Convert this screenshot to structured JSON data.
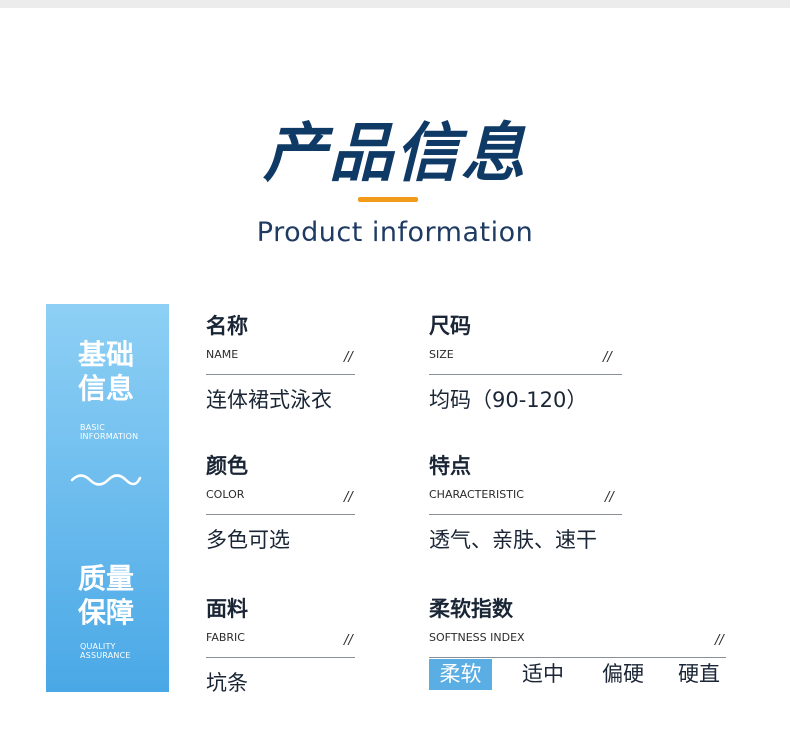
{
  "header": {
    "title": "产品信息",
    "subtitle": "Product information"
  },
  "colors": {
    "title": "#0f3a66",
    "accent_underline": "#f29a1a",
    "sidebar_top": "#8ed0f5",
    "sidebar_bottom": "#4aa8e6",
    "softness_active": "#5aaee3"
  },
  "sidebar": {
    "basic_title_line1": "基础",
    "basic_title_line2": "信息",
    "basic_sub_line1": "BASIC",
    "basic_sub_line2": "INFORMATION",
    "wave_icon": "wave-icon",
    "quality_title_line1": "质量",
    "quality_title_line2": "保障",
    "quality_sub_line1": "QUALITY",
    "quality_sub_line2": "ASSURANCE"
  },
  "fields": {
    "name": {
      "label": "名称",
      "en": "NAME",
      "slash": "//",
      "value": "连体裙式泳衣"
    },
    "size": {
      "label": "尺码",
      "en": "SIZE",
      "slash": "//",
      "value": "均码（90-120）"
    },
    "color": {
      "label": "颜色",
      "en": "COLOR",
      "slash": "//",
      "value": "多色可选"
    },
    "feature": {
      "label": "特点",
      "en": "CHARACTERISTIC",
      "slash": "//",
      "value": "透气、亲肤、速干"
    },
    "fabric": {
      "label": "面料",
      "en": "FABRIC",
      "slash": "//",
      "value": "坑条"
    },
    "softness": {
      "label": "柔软指数",
      "en": "SOFTNESS INDEX",
      "slash": "//",
      "options": [
        "柔软",
        "适中",
        "偏硬",
        "硬直"
      ],
      "selected": "柔软"
    }
  }
}
